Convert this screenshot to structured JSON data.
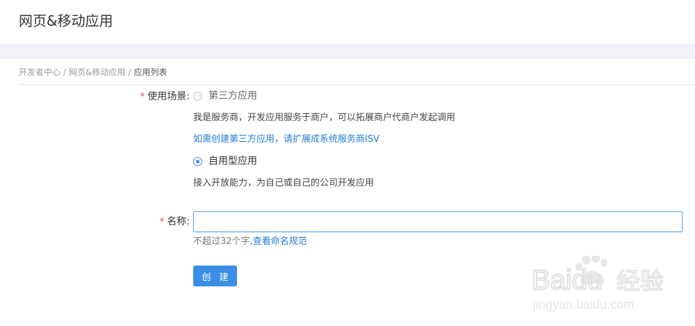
{
  "header": {
    "title": "网页&移动应用"
  },
  "breadcrumb": {
    "items": [
      "开发者中心",
      "网页&移动应用",
      "应用列表"
    ],
    "separator": "/"
  },
  "form": {
    "required_mark": "*",
    "scene": {
      "label": "使用场景:",
      "options": [
        {
          "label": "第三方应用",
          "checked": false,
          "description": "我是服务商，开发应用服务于商户，可以拓展商户代商户发起调用",
          "link": "如需创建第三方应用，请扩展成系统服务商ISV"
        },
        {
          "label": "自用型应用",
          "checked": true,
          "description": "接入开放能力，为自己或自己的公司开发应用"
        }
      ]
    },
    "name": {
      "label": "名称:",
      "value": "",
      "placeholder": "",
      "hint_text": "不超过32个字,",
      "hint_link": "查看命名规范"
    },
    "submit_label": "创 建"
  },
  "watermark": {
    "brand": "Baidu",
    "text": "经验",
    "url": "jingyan.baidu.com"
  },
  "colors": {
    "accent": "#3b8ee6",
    "link": "#1f7bd6",
    "required": "#e64340",
    "band": "#f0f2f7"
  }
}
